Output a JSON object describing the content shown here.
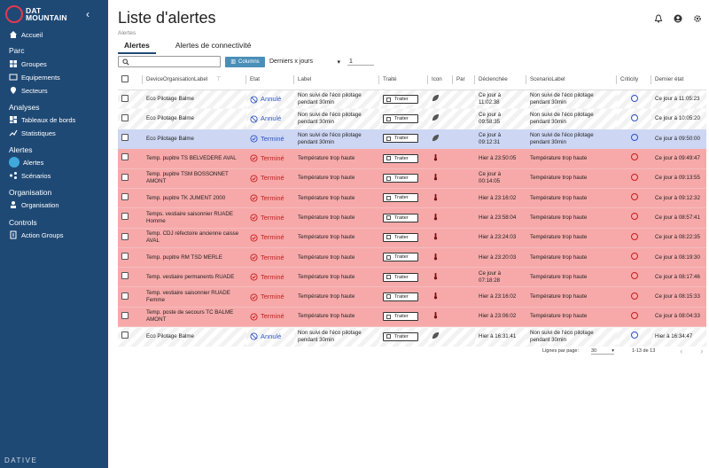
{
  "app": {
    "logo_line1": "DAT",
    "logo_line2": "MOUNTAIN",
    "brand": "DATIVE"
  },
  "sidebar": {
    "home": "Accueil",
    "sections": [
      {
        "title": "Parc",
        "items": [
          "Groupes",
          "Equipements",
          "Secteurs"
        ]
      },
      {
        "title": "Analyses",
        "items": [
          "Tableaux de bords",
          "Statistiques"
        ]
      },
      {
        "title": "Alertes",
        "items": [
          "Alertes",
          "Scénarios"
        ]
      },
      {
        "title": "Organisation",
        "items": [
          "Organisation"
        ]
      },
      {
        "title": "Controls",
        "items": [
          "Action Groups"
        ]
      }
    ]
  },
  "header": {
    "title": "Liste d'alertes",
    "breadcrumb": "Alertes"
  },
  "tabs": [
    "Alertes",
    "Alertes de connectivité"
  ],
  "toolbar": {
    "columns_label": "Columns",
    "period": "Derniers x jours",
    "days": "1"
  },
  "columns": [
    "DeviceOrganisationLabel",
    "Etat",
    "Label",
    "Traité",
    "Icon",
    "Par",
    "Déclenchée",
    "ScenarioLabel",
    "Criticity",
    "Dernier état"
  ],
  "traiter_label": "Traiter",
  "rows": [
    {
      "device": "Eco Pilotage Balme",
      "etat": "Annulé",
      "label": "Non suivi de l'éco pilotage pendant 30min",
      "decl": "Ce jour à 11:02:38",
      "scenario": "Non suivi de l'éco pilotage pendant 30min",
      "last": "Ce jour à 11:05:23",
      "style": "ann"
    },
    {
      "device": "Eco Pilotage Balme",
      "etat": "Annulé",
      "label": "Non suivi de l'éco pilotage pendant 30min",
      "decl": "Ce jour à 09:58:35",
      "scenario": "Non suivi de l'éco pilotage pendant 30min",
      "last": "Ce jour à 10:05:20",
      "style": "ann"
    },
    {
      "device": "Eco Pilotage Balme",
      "etat": "Terminé",
      "label": "Non suivi de l'éco pilotage pendant 30min",
      "decl": "Ce jour à 09:12:31",
      "scenario": "Non suivi de l'éco pilotage pendant 30min",
      "last": "Ce jour à 09:50:00",
      "style": "sel"
    },
    {
      "device": "Temp. pupitre TS BELVEDERE AVAL",
      "etat": "Terminé",
      "label": "Température trop haute",
      "decl": "Hier à 23:50:05",
      "scenario": "Température trop haute",
      "last": "Ce jour à 09:49:47",
      "style": "red"
    },
    {
      "device": "Temp. pupitre TSM BOSSONNET AMONT",
      "etat": "Terminé",
      "label": "Température trop haute",
      "decl": "Ce jour à 00:14:05",
      "scenario": "Température trop haute",
      "last": "Ce jour à 09:13:55",
      "style": "red"
    },
    {
      "device": "Temp. pupitre TK JUMENT 2000",
      "etat": "Terminé",
      "label": "Température trop haute",
      "decl": "Hier à 23:16:02",
      "scenario": "Température trop haute",
      "last": "Ce jour à 09:12:32",
      "style": "red"
    },
    {
      "device": "Temps. vestiaire saisonnier RUADE Homme",
      "etat": "Terminé",
      "label": "Température trop haute",
      "decl": "Hier à 23:58:04",
      "scenario": "Température trop haute",
      "last": "Ce jour à 08:57:41",
      "style": "red"
    },
    {
      "device": "Temp. CDJ réfectoire ancienne caisse AVAL",
      "etat": "Terminé",
      "label": "Température trop haute",
      "decl": "Hier à 23:24:03",
      "scenario": "Température trop haute",
      "last": "Ce jour à 08:22:35",
      "style": "red"
    },
    {
      "device": "Temp. pupitre RM TSD MERLE",
      "etat": "Terminé",
      "label": "Température trop haute",
      "decl": "Hier à 23:20:03",
      "scenario": "Température trop haute",
      "last": "Ce jour à 08:19:30",
      "style": "red"
    },
    {
      "device": "Temp. vestiaire permanents RUADE",
      "etat": "Terminé",
      "label": "Température trop haute",
      "decl": "Ce jour à 07:18:28",
      "scenario": "Température trop haute",
      "last": "Ce jour à 08:17:46",
      "style": "red"
    },
    {
      "device": "Temp. vestiaire saisonnier RUADE Femme",
      "etat": "Terminé",
      "label": "Température trop haute",
      "decl": "Hier à 23:16:02",
      "scenario": "Température trop haute",
      "last": "Ce jour à 08:15:33",
      "style": "red"
    },
    {
      "device": "Temp. poste de secours TC BALME AMONT",
      "etat": "Terminé",
      "label": "Température trop haute",
      "decl": "Hier à 23:06:02",
      "scenario": "Température trop haute",
      "last": "Ce jour à 08:04:33",
      "style": "red"
    },
    {
      "device": "Eco Pilotage Balme",
      "etat": "Annulé",
      "label": "Non suivi de l'éco pilotage pendant 30min",
      "decl": "Hier à 16:31:41",
      "scenario": "Non suivi de l'éco pilotage pendant 30min",
      "last": "Hier à 16:34:47",
      "style": "ann"
    }
  ],
  "pagination": {
    "label": "Lignes par page:",
    "per_page": "30",
    "range": "1-13 de 13"
  }
}
